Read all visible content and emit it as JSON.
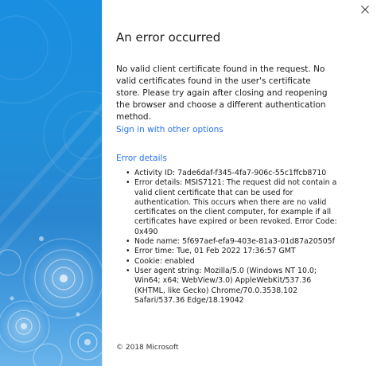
{
  "window": {
    "close_glyph": "✕"
  },
  "main": {
    "title": "An error occurred",
    "message": "No valid client certificate found in the request. No valid certificates found in the user's certificate store. Please try again after closing and reopening the browser and choose a different authentication method.",
    "signin_link": "Sign in with other options",
    "details_heading": "Error details",
    "details": [
      "Activity ID: 7ade6daf-f345-4fa7-906c-55c1ffcb8710",
      "Error details: MSIS7121: The request did not contain a valid client certificate that can be used for authentication. This occurs when there are no valid certificates on the client computer, for example if all certificates have expired or been revoked. Error Code: 0x490",
      "Node name: 5f697aef-efa9-403e-81a3-01d87a20505f",
      "Error time: Tue, 01 Feb 2022 17:36:57 GMT",
      "Cookie: enabled",
      "User agent string: Mozilla/5.0 (Windows NT 10.0; Win64; x64; WebView/3.0) AppleWebKit/537.36 (KHTML, like Gecko) Chrome/70.0.3538.102 Safari/537.36 Edge/18.19042"
    ],
    "footer": "© 2018 Microsoft"
  },
  "colors": {
    "link": "#2672ec",
    "panel": "#1f8fd9"
  },
  "icons": {
    "close": "close-icon"
  }
}
